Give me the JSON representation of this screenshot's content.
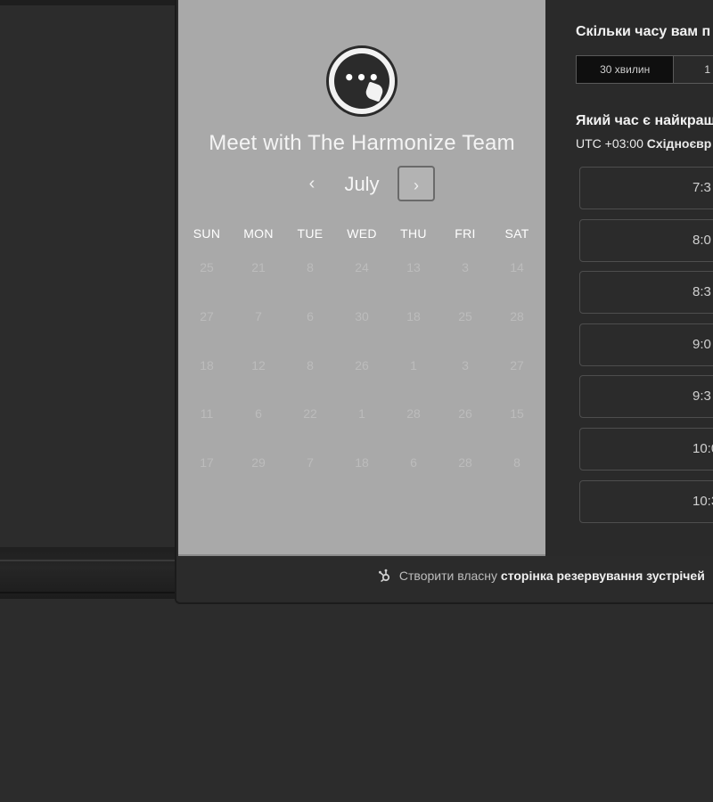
{
  "meeting": {
    "title": "Meet with The Harmonize Team",
    "logo_icon": "chat-bubble-icon",
    "logo_dots": "•••"
  },
  "calendar": {
    "month": "July",
    "prev_icon": "‹",
    "next_icon": "›",
    "weekdays": [
      "SUN",
      "MON",
      "TUE",
      "WED",
      "THU",
      "FRI",
      "SAT"
    ],
    "weeks": [
      [
        "25",
        "21",
        "8",
        "24",
        "13",
        "3",
        "14"
      ],
      [
        "27",
        "7",
        "6",
        "30",
        "18",
        "25",
        "28"
      ],
      [
        "18",
        "12",
        "8",
        "26",
        "1",
        "3",
        "27"
      ],
      [
        "11",
        "6",
        "22",
        "1",
        "28",
        "26",
        "15"
      ],
      [
        "17",
        "29",
        "7",
        "18",
        "6",
        "28",
        "8"
      ]
    ]
  },
  "duration": {
    "question": "Скільки часу вам п",
    "options": [
      "30 хвилин",
      "1"
    ]
  },
  "times": {
    "question": "Який час є найкращ",
    "timezone_prefix": "UTC +03:00 ",
    "timezone_name": "Східноєвр",
    "slots": [
      "7:3",
      "8:0",
      "8:3",
      "9:0",
      "9:3",
      "10:0",
      "10:3"
    ]
  },
  "footer": {
    "prefix": "Створити власну ",
    "link": "сторінка резервування зустрічей",
    "icon": "sprocket-icon"
  }
}
